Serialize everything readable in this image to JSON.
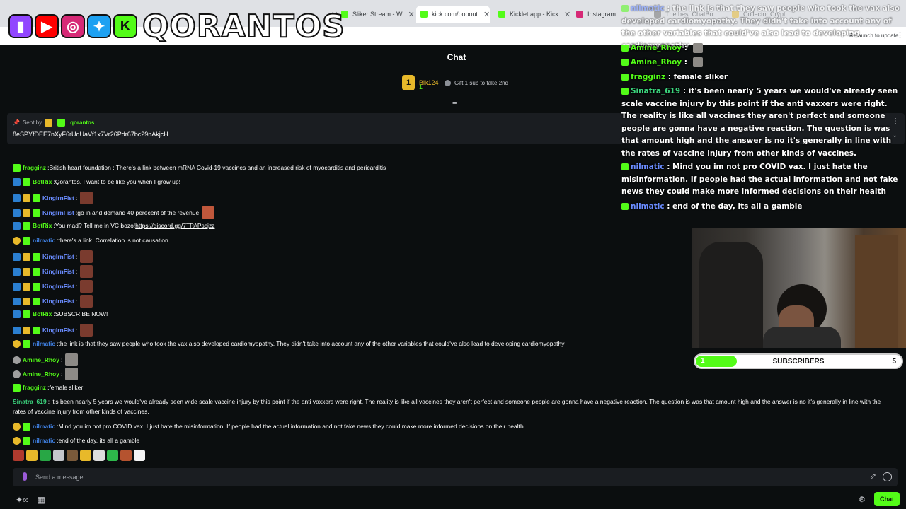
{
  "browser": {
    "tabs": [
      {
        "label": "Sliker Stream - W",
        "color": "#53fc18"
      },
      {
        "label": "kick.com/popout",
        "color": "#53fc18"
      },
      {
        "label": "Kicklet.app - Kick",
        "color": "#53fc18"
      },
      {
        "label": "Instagram",
        "color": "#d62976"
      },
      {
        "label": "The best ChatBo",
        "color": "#6a6a6a"
      },
      {
        "label": "Collector Crypt",
        "color": "#e8b92a"
      }
    ],
    "update_button": "Relaunch to update"
  },
  "overlay_logo": {
    "text": "QORANTOS"
  },
  "chat": {
    "title": "Chat",
    "top_gifter": {
      "rank": "1",
      "name": "Blk124",
      "subs": "1"
    },
    "gift_prompt": "Gift 1 sub to take 2nd",
    "pinned": {
      "sent_by_label": "Sent by",
      "sent_by_user": "qorantos",
      "text": "8eSPYfDEE7nXyF6rUqUaVf1x7Vr26Pdr67bc29nAkjcH"
    },
    "messages": [
      {
        "user": "fragginz",
        "color": "#53fc18",
        "text": "British heart foundation : There's a link between mRNA Covid-19 vaccines and an increased risk of myocarditis and pericarditis"
      },
      {
        "user": "BotRix",
        "color": "#53fc18",
        "text": "Qorantos. I want to be like you when I grow up!"
      },
      {
        "user": "KingIrnFist",
        "color": "#6a8cff",
        "text": ""
      },
      {
        "user": "KingIrnFist",
        "color": "#6a8cff",
        "text": "go in and demand 40 perecent of the revenue"
      },
      {
        "user": "BotRix",
        "color": "#53fc18",
        "text": "You mad? Tell me in VC bozo!",
        "link": "https://discord.gg/7TPAPscjzz"
      },
      {
        "user": "nilmatic",
        "color": "#3f7fe0",
        "text": "there's a link. Correlation is not causation"
      },
      {
        "user": "KingIrnFist",
        "color": "#6a8cff",
        "text": ""
      },
      {
        "user": "KingIrnFist",
        "color": "#6a8cff",
        "text": ""
      },
      {
        "user": "KingIrnFist",
        "color": "#6a8cff",
        "text": ""
      },
      {
        "user": "KingIrnFist",
        "color": "#6a8cff",
        "text": ""
      },
      {
        "user": "BotRix",
        "color": "#53fc18",
        "text": "SUBSCRIBE NOW!"
      },
      {
        "user": "KingIrnFist",
        "color": "#6a8cff",
        "text": ""
      },
      {
        "user": "nilmatic",
        "color": "#3f7fe0",
        "text": "the link is that they saw people who took the vax also developed cardiomyopathy. They didn't take into account any of the other variables that could've also lead to developing cardiomyopathy"
      },
      {
        "user": "Amine_Rhoy",
        "color": "#53fc18",
        "text": ""
      },
      {
        "user": "Amine_Rhoy",
        "color": "#53fc18",
        "text": ""
      },
      {
        "user": "fragginz",
        "color": "#53fc18",
        "text": "female sliker"
      },
      {
        "user": "Sinatra_619",
        "color": "#3bd47d",
        "text": "it's been nearly 5 years we would've already seen wide scale vaccine injury by this point if the anti vaxxers were right. The reality is like all vaccines they aren't perfect and someone people are gonna have a negative reaction. The question is was that amount high and the answer is no it's generally in line with the rates of vaccine injury from other kinds of vaccines."
      },
      {
        "user": "nilmatic",
        "color": "#3f7fe0",
        "text": "Mind you im not pro COVID vax. I just hate the misinformation. If people had the actual information and not fake news they could make more informed decisions on their health"
      },
      {
        "user": "nilmatic",
        "color": "#3f7fe0",
        "text": "end of the day, its all a gamble"
      }
    ],
    "input_placeholder": "Send a message",
    "chat_button": "Chat"
  },
  "overlay_chat": [
    {
      "user": "nilmatic",
      "text": "the link is that they saw people who took the vax also developed cardiomyopathy. They didn't take into account any of the other variables that could've also lead to developing cardiomyopathy"
    },
    {
      "user": "Amine_Rhoy",
      "text": ""
    },
    {
      "user": "Amine_Rhoy",
      "text": ""
    },
    {
      "user": "fragginz",
      "text": "female sliker"
    },
    {
      "user": "Sinatra_619",
      "text": "it's been nearly 5 years we would've already seen scale vaccine injury by this point if the anti vaxxers were right. The reality is like all vaccines they aren't perfect and someone people are gonna have a negative reaction. The question is was that amount high and the answer is no it's generally in line with the rates of vaccine injury from other kinds of vaccines."
    },
    {
      "user": "nilmatic",
      "text": "Mind you im not pro COVID vax. I just hate the misinformation. If people had the actual information and not fake news they could make more informed decisions on their health"
    },
    {
      "user": "nilmatic",
      "text": "end of the day, its all a gamble"
    }
  ],
  "subs_goal": {
    "label": "SUBSCRIBERS",
    "current": "1",
    "goal": "5",
    "progress": 0.2
  }
}
